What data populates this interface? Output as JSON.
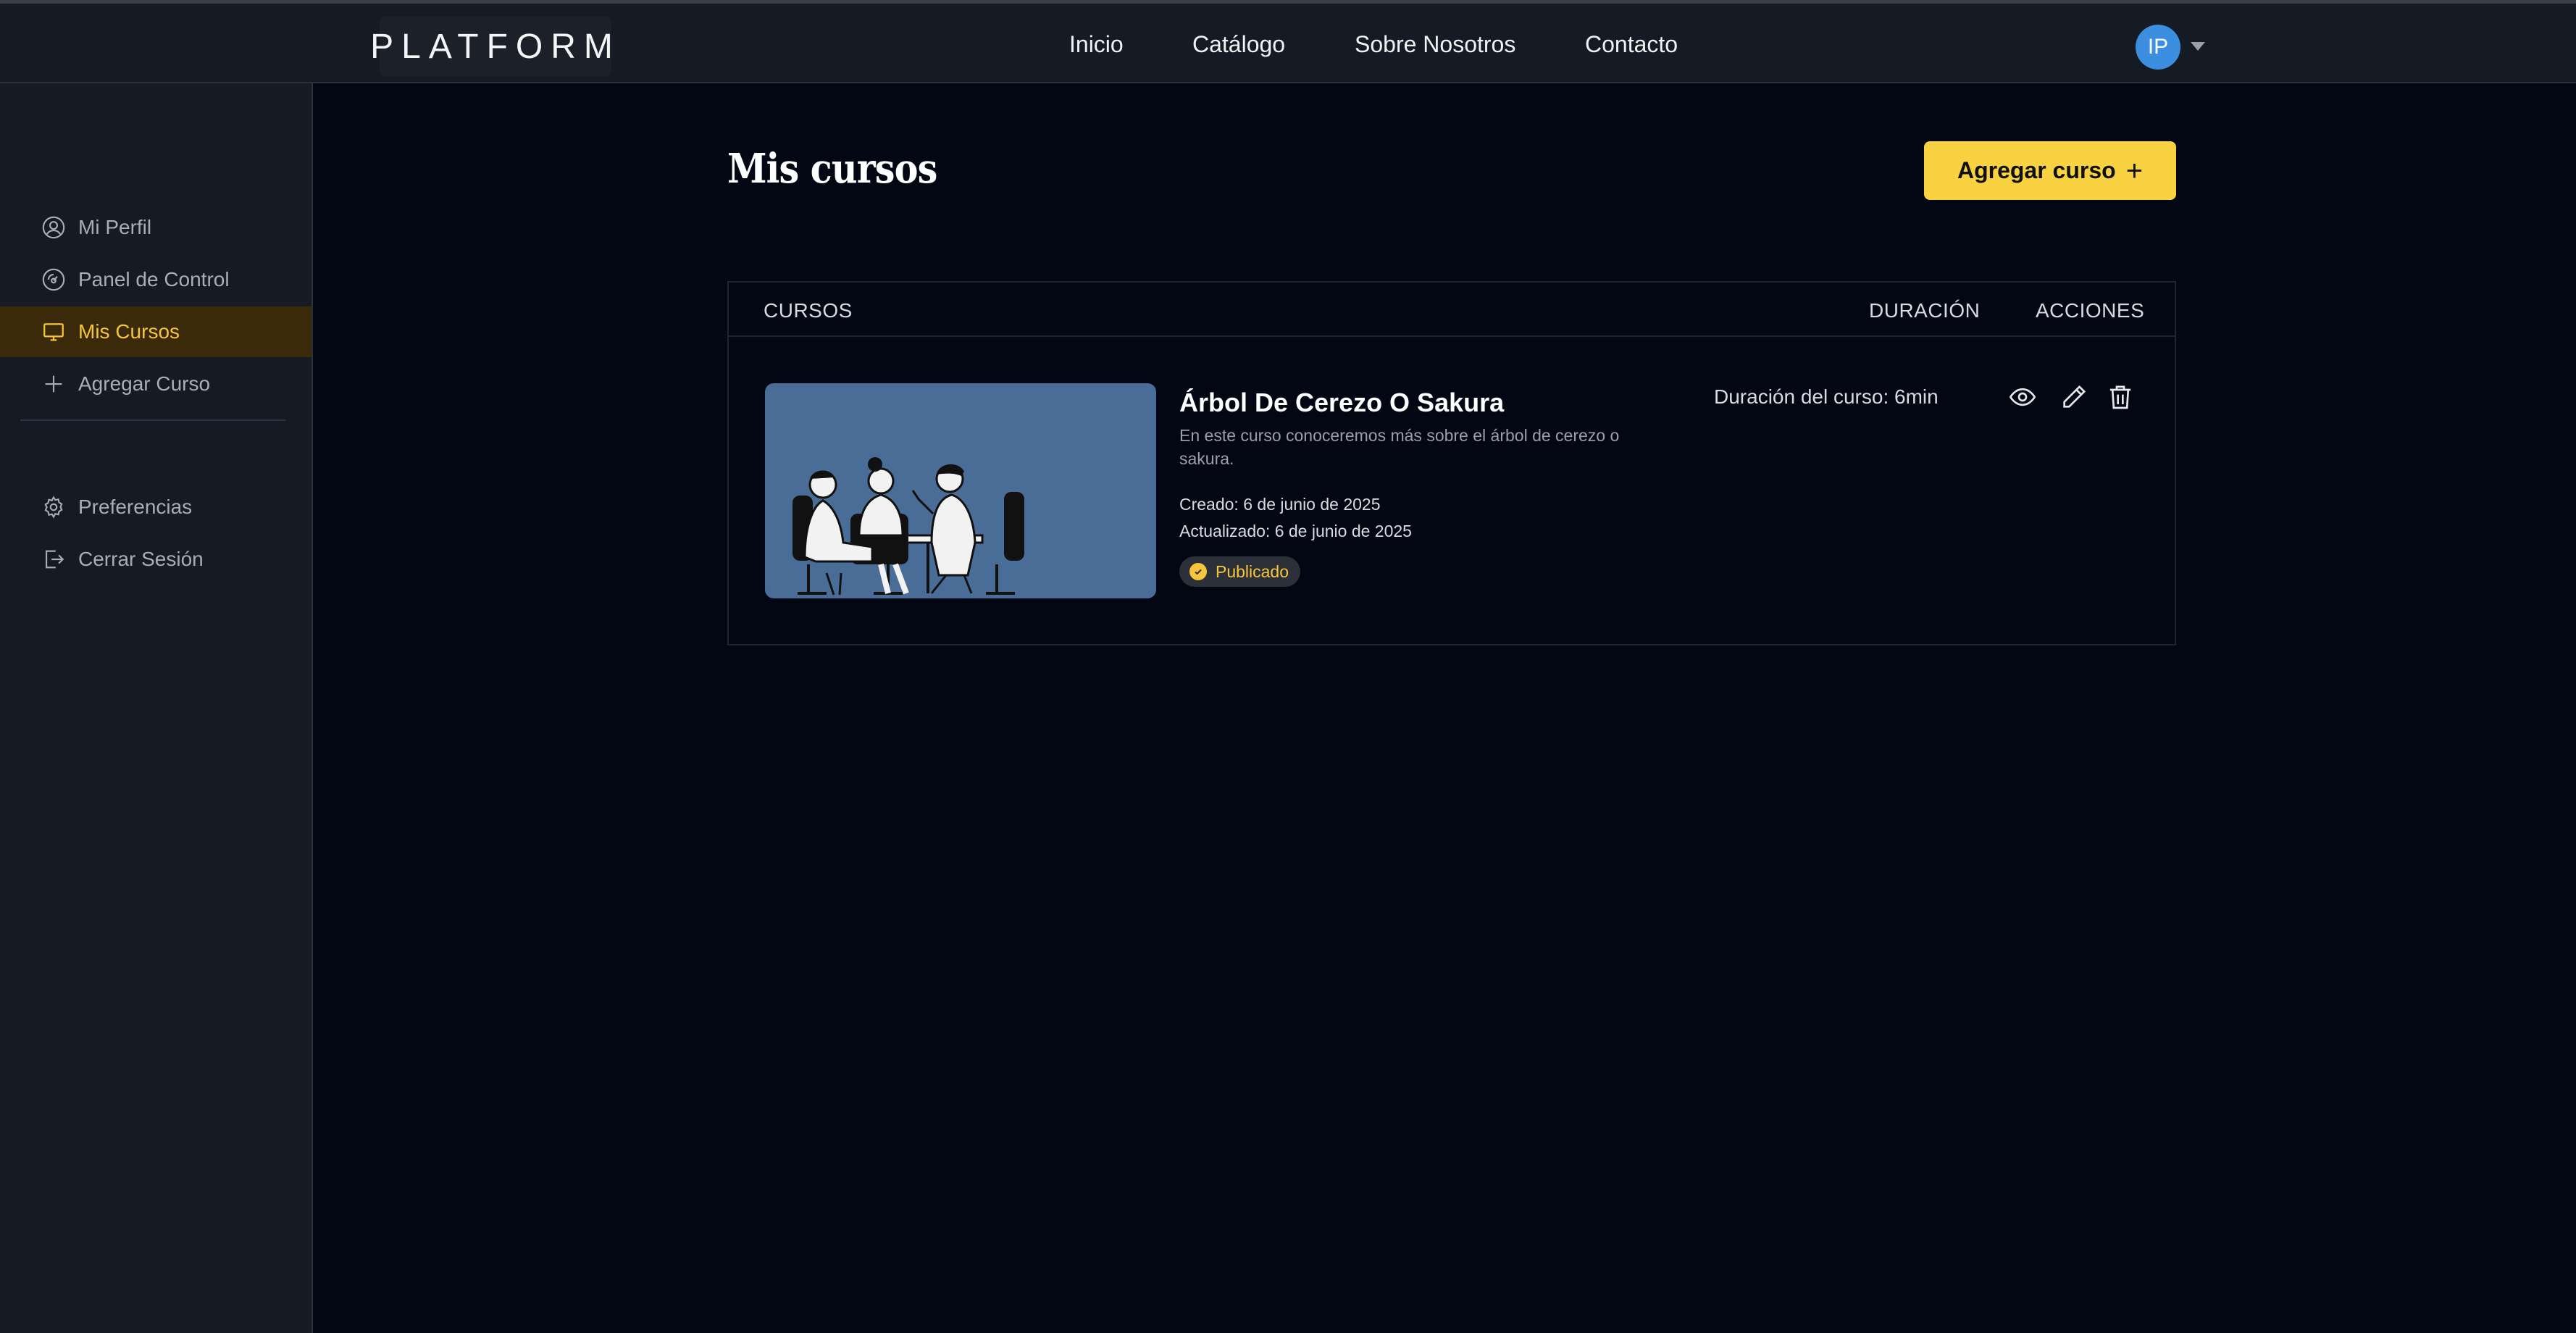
{
  "header": {
    "logo": "PLATFORM",
    "nav": [
      "Inicio",
      "Catálogo",
      "Sobre Nosotros",
      "Contacto"
    ],
    "avatar_initials": "IP",
    "avatar_icon": "chevron-down-icon"
  },
  "sidebar": {
    "items": [
      {
        "label": "Mi Perfil",
        "icon": "user-circle-icon"
      },
      {
        "label": "Panel de Control",
        "icon": "dashboard-gauge-icon"
      },
      {
        "label": "Mis Cursos",
        "icon": "monitor-icon",
        "active": true
      },
      {
        "label": "Agregar Curso",
        "icon": "plus-icon"
      },
      {
        "label": "Preferencias",
        "icon": "gear-icon"
      },
      {
        "label": "Cerrar Sesión",
        "icon": "logout-icon"
      }
    ]
  },
  "main": {
    "title": "Mis cursos",
    "add_button_label": "Agregar curso",
    "table": {
      "columns": [
        "CURSOS",
        "DURACIÓN",
        "ACCIONES"
      ],
      "rows": [
        {
          "title": "Árbol De Cerezo O Sakura",
          "description": "En este curso conoceremos más sobre el árbol de cerezo o sakura.",
          "created": "Creado: 6 de junio de 2025",
          "updated": "Actualizado: 6 de junio de 2025",
          "status": "Publicado",
          "duration": "Duración del curso: 6min",
          "actions": [
            "eye-icon",
            "pencil-icon",
            "trash-icon"
          ]
        }
      ]
    }
  },
  "colors": {
    "accent": "#f8d241",
    "background": "#020713",
    "panel": "#151b24",
    "thumbnail": "#4a6d98",
    "avatar": "#3b8fde"
  }
}
